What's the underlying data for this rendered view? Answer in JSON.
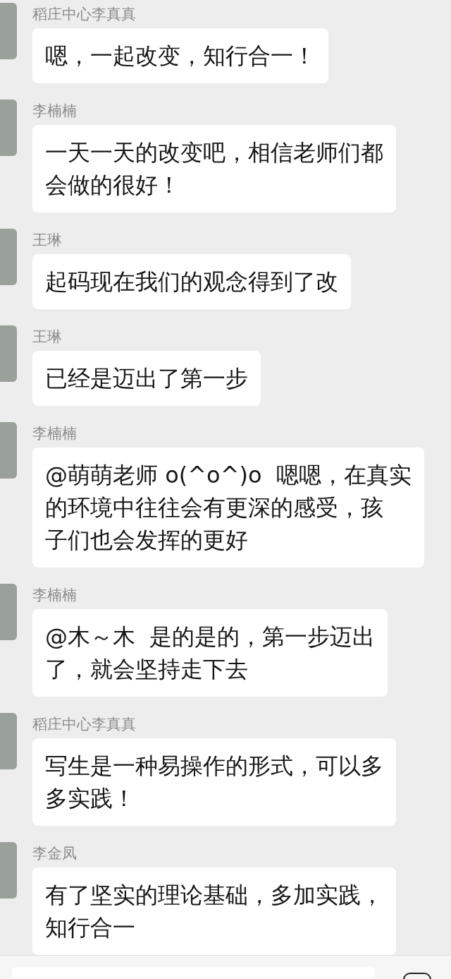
{
  "messages": [
    {
      "sender": "稻庄中心李真真",
      "lines": [
        "嗯，一起改变，知行合一！"
      ]
    },
    {
      "sender": "李楠楠",
      "lines": [
        "一天一天的改变吧，相信老师们都",
        "会做的很好！"
      ]
    },
    {
      "sender": "王琳",
      "lines": [
        "起码现在我们的观念得到了改"
      ]
    },
    {
      "sender": "王琳",
      "lines": [
        "已经是迈出了第一步"
      ]
    },
    {
      "sender": "李楠楠",
      "lines": [
        "@萌萌老师 o(^o^)o  嗯嗯，在真实",
        "的环境中往往会有更深的感受，孩",
        "子们也会发挥的更好"
      ]
    },
    {
      "sender": "李楠楠",
      "lines": [
        "@木～木  是的是的，第一步迈出",
        "了，就会坚持走下去"
      ]
    },
    {
      "sender": "稻庄中心李真真",
      "lines": [
        "写生是一种易操作的形式，可以多",
        "多实践！"
      ]
    },
    {
      "sender": "李金凤",
      "lines": [
        "有了坚实的理论基础，多加实践，",
        "知行合一"
      ]
    }
  ]
}
